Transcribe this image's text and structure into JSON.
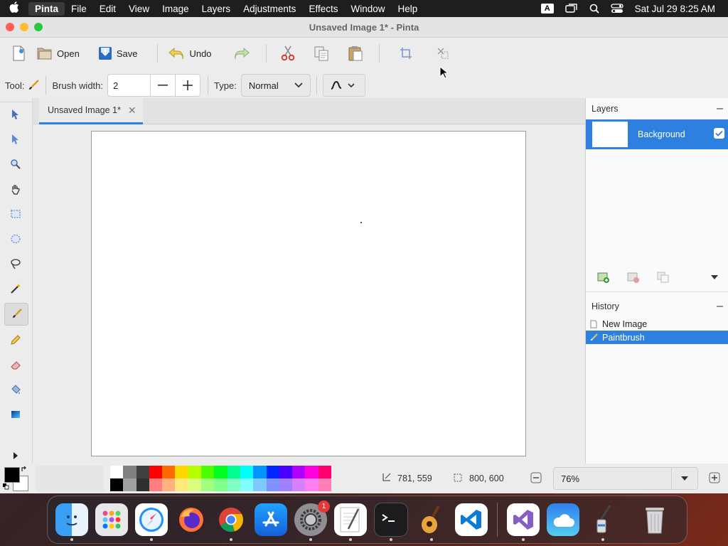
{
  "menubar": {
    "app_name": "Pinta",
    "items": [
      "File",
      "Edit",
      "View",
      "Image",
      "Layers",
      "Adjustments",
      "Effects",
      "Window",
      "Help"
    ],
    "input_indicator": "A",
    "datetime": "Sat Jul 29  8:25 AM"
  },
  "window": {
    "title": "Unsaved Image 1* - Pinta"
  },
  "toolbar": {
    "open_label": "Open",
    "save_label": "Save",
    "undo_label": "Undo"
  },
  "options": {
    "tool_label": "Tool:",
    "brush_width_label": "Brush width:",
    "brush_width_value": "2",
    "type_label": "Type:",
    "type_value": "Normal"
  },
  "document_tab": {
    "label": "Unsaved Image 1*"
  },
  "layers": {
    "header": "Layers",
    "items": [
      {
        "name": "Background",
        "visible": true
      }
    ]
  },
  "history": {
    "header": "History",
    "items": [
      {
        "label": "New Image",
        "selected": false
      },
      {
        "label": "Paintbrush",
        "selected": true
      }
    ]
  },
  "status": {
    "cursor_position": "781, 559",
    "image_size": "800, 600",
    "zoom": "76%"
  },
  "colors": {
    "accent": "#2d7fe0",
    "primary_color": "#000000",
    "secondary_color": "#ffffff"
  },
  "palette": {
    "top": [
      "#ffffff",
      "#808080",
      "#404040",
      "#ff0000",
      "#ff6a00",
      "#ffd800",
      "#b6ff00",
      "#4cff00",
      "#00ff21",
      "#00ff90",
      "#00ffff",
      "#0094ff",
      "#0026ff",
      "#4800ff",
      "#b200ff",
      "#ff00dc",
      "#ff006e"
    ],
    "bottom": [
      "#000000",
      "#a0a0a0",
      "#303030",
      "#ff7f7f",
      "#ffb27f",
      "#ffe97f",
      "#daff7f",
      "#a5ff7f",
      "#7fff8e",
      "#7fffc5",
      "#7fffff",
      "#7fc9ff",
      "#7f92ff",
      "#a17fff",
      "#d67fff",
      "#ff7fed",
      "#ff7fb6"
    ]
  },
  "dock": {
    "apps": [
      "finder-icon",
      "launchpad-icon",
      "safari-icon",
      "firefox-icon",
      "chrome-icon",
      "app-store-icon",
      "system-settings-icon",
      "textedit-icon",
      "terminal-icon",
      "garageband-icon",
      "vscode-icon",
      "visual-studio-icon",
      "weather-icon",
      "pinta-icon",
      "trash-icon"
    ],
    "settings_badge": "1"
  }
}
